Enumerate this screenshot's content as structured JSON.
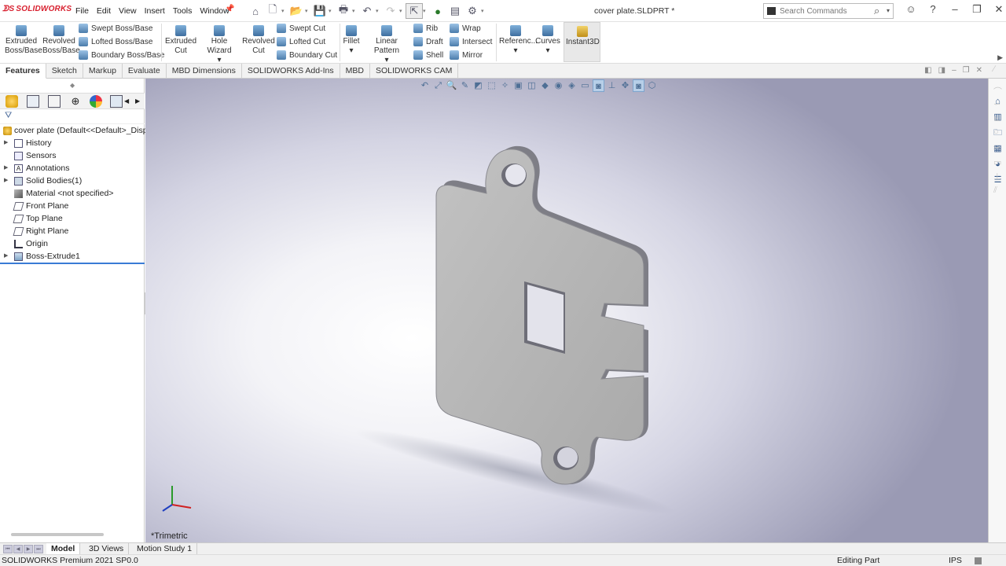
{
  "app": {
    "logo": "SOLIDWORKS",
    "document_title": "cover plate.SLDPRT *"
  },
  "menu": [
    "File",
    "Edit",
    "View",
    "Insert",
    "Tools",
    "Window"
  ],
  "search": {
    "placeholder": "Search Commands"
  },
  "ribbon": {
    "extruded_boss": [
      "Extruded",
      "Boss/Base"
    ],
    "revolved_boss": [
      "Revolved",
      "Boss/Base"
    ],
    "swept_boss": "Swept Boss/Base",
    "lofted_boss": "Lofted Boss/Base",
    "boundary_boss": "Boundary Boss/Base",
    "extruded_cut": [
      "Extruded",
      "Cut"
    ],
    "hole_wizard": "Hole Wizard",
    "revolved_cut": [
      "Revolved",
      "Cut"
    ],
    "swept_cut": "Swept Cut",
    "lofted_cut": "Lofted Cut",
    "boundary_cut": "Boundary Cut",
    "fillet": "Fillet",
    "linear_pattern": "Linear Pattern",
    "rib": "Rib",
    "draft": "Draft",
    "shell": "Shell",
    "wrap": "Wrap",
    "intersect": "Intersect",
    "mirror": "Mirror",
    "reference": "Referenc...",
    "curves": "Curves",
    "instant3d": "Instant3D"
  },
  "tabs": [
    "Features",
    "Sketch",
    "Markup",
    "Evaluate",
    "MBD Dimensions",
    "SOLIDWORKS Add-Ins",
    "MBD",
    "SOLIDWORKS CAM"
  ],
  "feature_tree": {
    "root": "cover plate  (Default<<Default>_Disp",
    "items": [
      {
        "label": "History",
        "expandable": true,
        "icon": "history-icon"
      },
      {
        "label": "Sensors",
        "expandable": false,
        "icon": "sensor-icon"
      },
      {
        "label": "Annotations",
        "expandable": true,
        "icon": "annotation-icon"
      },
      {
        "label": "Solid Bodies(1)",
        "expandable": true,
        "icon": "solid-bodies-icon"
      },
      {
        "label": "Material <not specified>",
        "expandable": false,
        "icon": "material-icon"
      },
      {
        "label": "Front Plane",
        "expandable": false,
        "icon": "plane-icon"
      },
      {
        "label": "Top Plane",
        "expandable": false,
        "icon": "plane-icon"
      },
      {
        "label": "Right Plane",
        "expandable": false,
        "icon": "plane-icon"
      },
      {
        "label": "Origin",
        "expandable": false,
        "icon": "origin-icon"
      },
      {
        "label": "Boss-Extrude1",
        "expandable": true,
        "icon": "extrude-icon"
      }
    ]
  },
  "viewport": {
    "view_name": "*Trimetric"
  },
  "bottom_tabs": [
    "Model",
    "3D Views",
    "Motion Study 1"
  ],
  "status": {
    "version": "SOLIDWORKS Premium 2021 SP0.0",
    "mode": "Editing Part",
    "units": "IPS"
  },
  "colors": {
    "logo_red": "#d8202f",
    "part_gray": "#b7b7b7",
    "selection_blue": "#3a7bd5"
  }
}
